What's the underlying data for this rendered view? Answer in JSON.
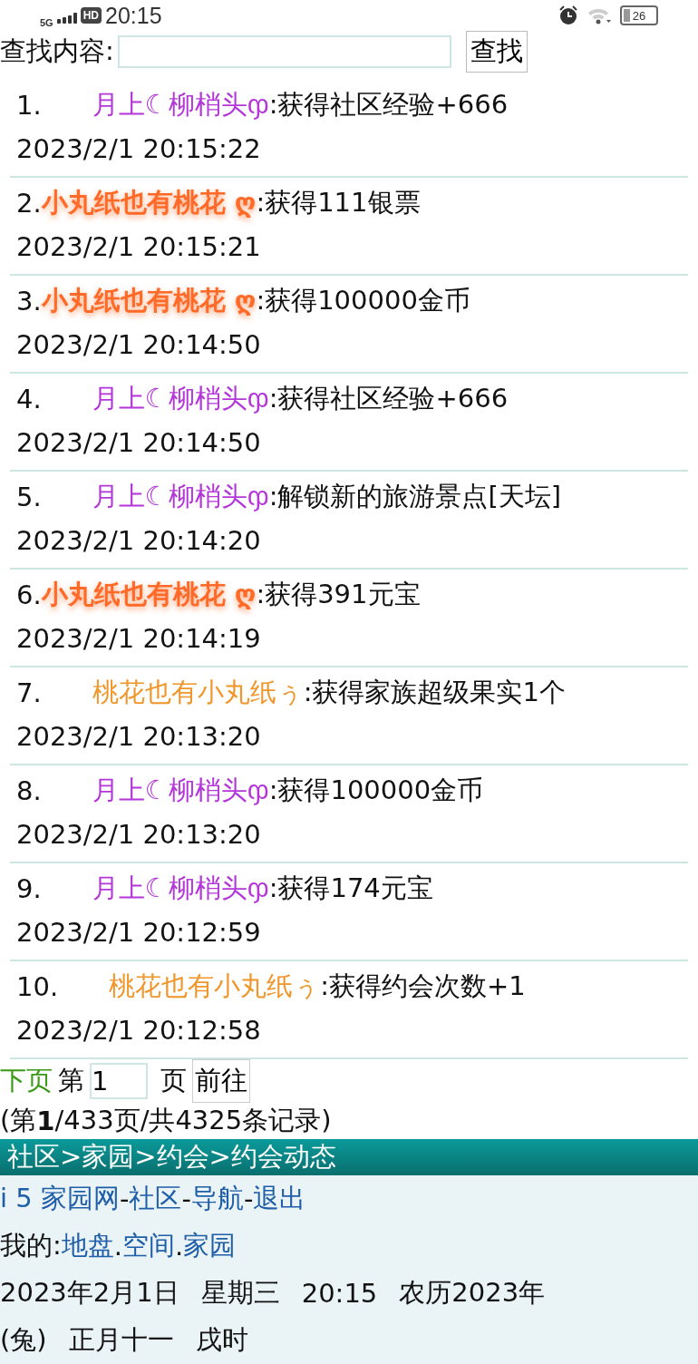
{
  "status_bar": {
    "network": "5G",
    "hd": "HD",
    "time": "20:15",
    "battery": "26"
  },
  "search": {
    "label": "查找内容:",
    "button": "查找"
  },
  "records": [
    {
      "number": "1.",
      "name": {
        "text": "月上☾柳梢头ჶ",
        "color": "#b436d8",
        "kind": "spaced"
      },
      "action": ":获得社区经验+666",
      "time": "2023/2/1 20:15:22"
    },
    {
      "number": "2.",
      "name": {
        "text": "小丸纸也有桃花 ღ",
        "color": "#ff6a28",
        "kind": "glow"
      },
      "action": ":获得111银票",
      "time": "2023/2/1 20:15:21"
    },
    {
      "number": "3.",
      "name": {
        "text": "小丸纸也有桃花 ღ",
        "color": "#ff6a28",
        "kind": "glow"
      },
      "action": ":获得100000金币",
      "time": "2023/2/1 20:14:50"
    },
    {
      "number": "4.",
      "name": {
        "text": "月上☾柳梢头ჶ",
        "color": "#b436d8",
        "kind": "spaced"
      },
      "action": ":获得社区经验+666",
      "time": "2023/2/1 20:14:50"
    },
    {
      "number": "5.",
      "name": {
        "text": "月上☾柳梢头ჶ",
        "color": "#b436d8",
        "kind": "spaced"
      },
      "action": ":解锁新的旅游景点[天坛]",
      "time": "2023/2/1 20:14:20"
    },
    {
      "number": "6.",
      "name": {
        "text": "小丸纸也有桃花 ღ",
        "color": "#ff6a28",
        "kind": "glow"
      },
      "action": ":获得391元宝",
      "time": "2023/2/1 20:14:19"
    },
    {
      "number": "7.",
      "name": {
        "text": "桃花也有小丸纸ぅ",
        "color": "#f0962a",
        "kind": "spaced"
      },
      "action": ":获得家族超级果实1个",
      "time": "2023/2/1 20:13:20"
    },
    {
      "number": "8.",
      "name": {
        "text": "月上☾柳梢头ჶ",
        "color": "#b436d8",
        "kind": "spaced"
      },
      "action": ":获得100000金币",
      "time": "2023/2/1 20:13:20"
    },
    {
      "number": "9.",
      "name": {
        "text": "月上☾柳梢头ჶ",
        "color": "#b436d8",
        "kind": "spaced"
      },
      "action": ":获得174元宝",
      "time": "2023/2/1 20:12:59"
    },
    {
      "number": "10.",
      "name": {
        "text": "桃花也有小丸纸ぅ",
        "color": "#f0962a",
        "kind": "spaced"
      },
      "action": ":获得约会次数+1",
      "time": "2023/2/1 20:12:58"
    }
  ],
  "pagination": {
    "next": "下页",
    "prefix": "第",
    "page_value": "1",
    "suffix": "页",
    "go": "前往",
    "summary": "(第**1**/433页/共4325条记录)"
  },
  "breadcrumb": "社区>家园>约会>约会动态",
  "nav_links": [
    {
      "text": "i 5 家园网"
    },
    {
      "text": "社区"
    },
    {
      "text": "导航"
    },
    {
      "text": "退出"
    }
  ],
  "nav_separator": "-",
  "mine": {
    "label": "我的:",
    "links": [
      {
        "text": "地盘"
      },
      {
        "text": "空间"
      },
      {
        "text": "家园"
      }
    ],
    "separator": "."
  },
  "date_line": [
    "2023年2月1日",
    "星期三",
    "20:15",
    "农历2023年"
  ],
  "lunar_line": [
    "(兔)",
    "正月十一",
    "戌时"
  ]
}
